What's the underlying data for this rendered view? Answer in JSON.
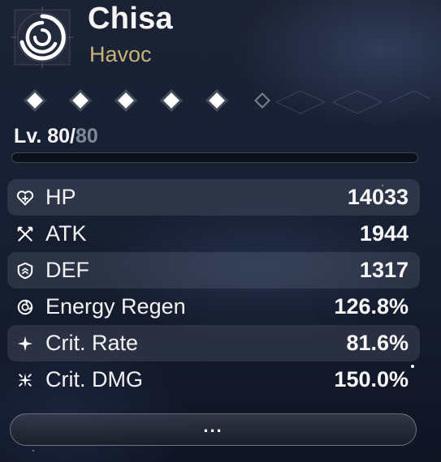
{
  "character": {
    "name": "Chisa",
    "element": "Havoc",
    "element_icon": "havoc-spiral-icon"
  },
  "resonance": {
    "total": 6,
    "filled": 5
  },
  "level": {
    "current": "80",
    "separator": "/",
    "prefix": "Lv. ",
    "max": "80"
  },
  "stats": [
    {
      "label": "HP",
      "value": "14033",
      "icon": "hp-icon"
    },
    {
      "label": "ATK",
      "value": "1944",
      "icon": "atk-icon"
    },
    {
      "label": "DEF",
      "value": "1317",
      "icon": "def-icon"
    },
    {
      "label": "Energy Regen",
      "value": "126.8%",
      "icon": "energy-regen-icon"
    },
    {
      "label": "Crit. Rate",
      "value": "81.6%",
      "icon": "crit-rate-icon"
    },
    {
      "label": "Crit. DMG",
      "value": "150.0%",
      "icon": "crit-dmg-icon"
    }
  ],
  "more_button": {
    "label": "..."
  },
  "colors": {
    "element_accent": "#c8b27a",
    "level_max_color": "#7d8899"
  }
}
